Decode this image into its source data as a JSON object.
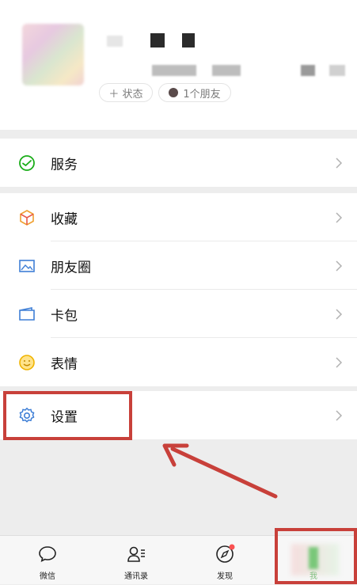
{
  "profile": {
    "status_chip": "＋ 状态",
    "friends_chip": "1个朋友"
  },
  "menu": [
    {
      "key": "service",
      "label": "服务",
      "icon": "wechat-pay-icon"
    },
    {
      "key": "favorites",
      "label": "收藏",
      "icon": "cube-icon"
    },
    {
      "key": "moments",
      "label": "朋友圈",
      "icon": "image-icon"
    },
    {
      "key": "cards",
      "label": "卡包",
      "icon": "wallet-card-icon"
    },
    {
      "key": "stickers",
      "label": "表情",
      "icon": "smiley-icon"
    },
    {
      "key": "settings",
      "label": "设置",
      "icon": "gear-icon"
    }
  ],
  "tabbar": {
    "items": [
      {
        "label": "微信",
        "icon": "chat-bubble-icon"
      },
      {
        "label": "通讯录",
        "icon": "contacts-icon"
      },
      {
        "label": "发现",
        "icon": "compass-icon",
        "badge": true
      },
      {
        "label": "我",
        "icon": "me-icon"
      }
    ]
  },
  "colors": {
    "highlight": "#c8403a",
    "green": "#1aad19",
    "background": "#ededed"
  }
}
